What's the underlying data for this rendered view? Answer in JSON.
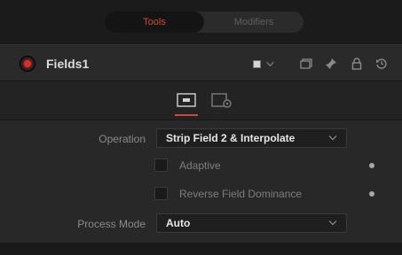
{
  "tabs": {
    "tools": "Tools",
    "modifiers": "Modifiers"
  },
  "header": {
    "tool_name": "Fields1",
    "swatch_color": "#d5d5d5",
    "node_color": "#e02a2a",
    "icons": [
      "versions-icon",
      "pin-icon",
      "lock-icon",
      "reset-icon"
    ]
  },
  "control_tabs": [
    "controls-icon",
    "settings-icon"
  ],
  "accent_color": "#d2453a",
  "controls": {
    "operation_label": "Operation",
    "operation_value": "Strip Field 2 & Interpolate",
    "adaptive_label": "Adaptive",
    "adaptive_checked": false,
    "reverse_label": "Reverse Field Dominance",
    "reverse_checked": false,
    "process_mode_label": "Process Mode",
    "process_mode_value": "Auto"
  }
}
